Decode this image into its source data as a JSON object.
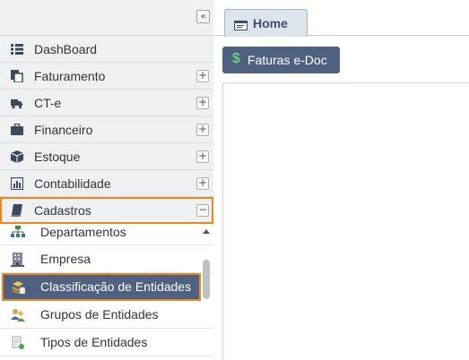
{
  "sidebar": {
    "collapse_glyph": "«",
    "menu": [
      {
        "label": "DashBoard",
        "icon": "list-icon",
        "expandable": false
      },
      {
        "label": "Faturamento",
        "icon": "documents-icon",
        "expandable": true
      },
      {
        "label": "CT-e",
        "icon": "truck-icon",
        "expandable": true
      },
      {
        "label": "Financeiro",
        "icon": "briefcase-icon",
        "expandable": true
      },
      {
        "label": "Estoque",
        "icon": "box-icon",
        "expandable": true
      },
      {
        "label": "Contabilidade",
        "icon": "bar-chart-icon",
        "expandable": true
      },
      {
        "label": "Cadastros",
        "icon": "book-icon",
        "expandable": true,
        "expanded": true
      }
    ],
    "expand_glyph": "+",
    "collapse_item_glyph": "−",
    "submenu": [
      {
        "label": "Departamentos",
        "icon": "org-chart-icon"
      },
      {
        "label": "Empresa",
        "icon": "building-icon"
      },
      {
        "label": "Classificação de Entidades",
        "icon": "stack-icon",
        "selected": true
      },
      {
        "label": "Grupos de Entidades",
        "icon": "group-icon"
      },
      {
        "label": "Tipos de Entidades",
        "icon": "tag-icon"
      }
    ]
  },
  "main": {
    "tabs": [
      {
        "label": "Home",
        "icon": "window-icon"
      }
    ],
    "toolbar": {
      "button_label": "Faturas e-Doc",
      "button_icon": "dollar-icon",
      "dollar_glyph": "$"
    }
  },
  "colors": {
    "accent_orange": "#f08519",
    "nav_selected": "#4f6181",
    "sidebar_bg": "#eef0f2",
    "tab_bg": "#dde4ee"
  }
}
